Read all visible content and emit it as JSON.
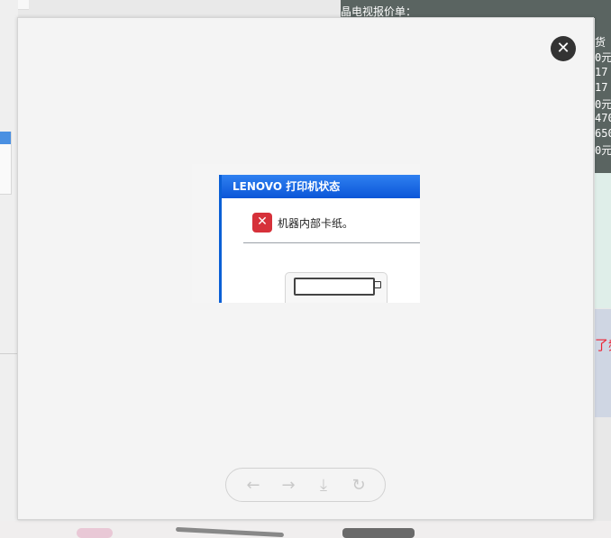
{
  "background": {
    "header_text": "晶电视报价单：",
    "right_prices": [
      "货",
      "0元",
      "17",
      "17",
      "0元",
      "470",
      "650",
      "0元"
    ],
    "right_red_text": "了频"
  },
  "viewer": {
    "image": {
      "window_title": "LENOVO 打印机状态",
      "error_message": "机器内部卡纸。",
      "error_icon": "error-x-icon"
    },
    "close_glyph": "✕",
    "toolbar": {
      "prev_glyph": "←",
      "next_glyph": "→",
      "download_glyph": "⤓",
      "rotate_glyph": "↻"
    }
  },
  "colors": {
    "title_bar": "#0b56d8",
    "error_icon": "#d6313a",
    "close_button": "#333333"
  }
}
